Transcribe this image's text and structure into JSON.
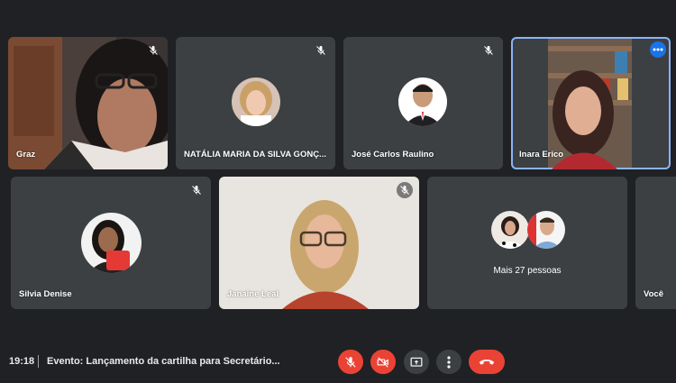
{
  "participants": [
    {
      "name": "Graz"
    },
    {
      "name": "NATÁLIA MARIA DA SILVA GONÇ..."
    },
    {
      "name": "José Carlos Raulino"
    },
    {
      "name": "Inara Erico"
    },
    {
      "name": "Silvia Denise"
    },
    {
      "name": "Janaine Leal"
    },
    {
      "name": "Você"
    }
  ],
  "overflow_tile": {
    "label": "Mais 27 pessoas"
  },
  "bottom_bar": {
    "time": "19:18",
    "meeting_title": "Evento: Lançamento da cartilha para Secretário..."
  },
  "icons": {
    "mic_off": "mic-off-icon",
    "cam_off": "camera-off-icon",
    "present": "present-screen-icon",
    "more": "more-vert-icon",
    "hangup": "hang-up-icon"
  },
  "colors": {
    "background": "#202124",
    "tile": "#3c4043",
    "danger": "#ea4335",
    "active_border": "#8ab4f8"
  }
}
